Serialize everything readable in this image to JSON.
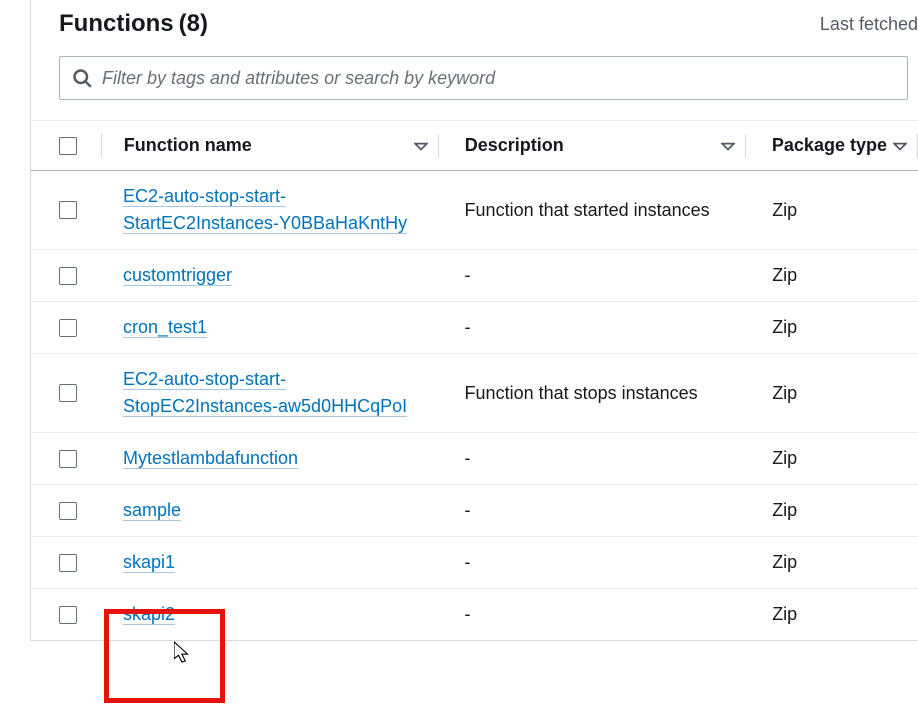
{
  "header": {
    "title": "Functions",
    "count": "(8)",
    "last_fetched": "Last fetched"
  },
  "search": {
    "placeholder": "Filter by tags and attributes or search by keyword"
  },
  "columns": {
    "name": "Function name",
    "description": "Description",
    "package_type": "Package type"
  },
  "rows": [
    {
      "name": "EC2-auto-stop-start-StartEC2Instances-Y0BBaHaKntHy",
      "description": "Function that started instances",
      "package": "Zip"
    },
    {
      "name": "customtrigger",
      "description": "-",
      "package": "Zip"
    },
    {
      "name": "cron_test1",
      "description": "-",
      "package": "Zip"
    },
    {
      "name": "EC2-auto-stop-start-StopEC2Instances-aw5d0HHCqPoI",
      "description": "Function that stops instances",
      "package": "Zip"
    },
    {
      "name": "Mytestlambdafunction",
      "description": "-",
      "package": "Zip"
    },
    {
      "name": "sample",
      "description": "-",
      "package": "Zip"
    },
    {
      "name": "skapi1",
      "description": "-",
      "package": "Zip"
    },
    {
      "name": "skapi2",
      "description": "-",
      "package": "Zip"
    }
  ]
}
